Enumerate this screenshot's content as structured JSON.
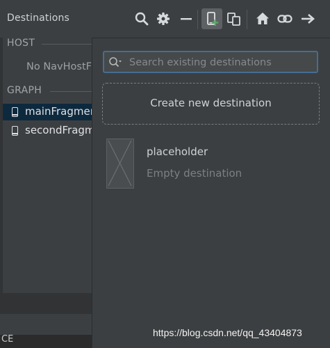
{
  "header": {
    "title": "Destinations",
    "icons": [
      "search-icon",
      "gear-icon",
      "minus-icon",
      "new-destination-icon",
      "nested-graph-icon",
      "home-icon",
      "link-icon",
      "arrow-right-icon"
    ]
  },
  "left_panel": {
    "host_section_label": "HOST",
    "host_value": "No NavHostFragments found",
    "graph_section_label": "GRAPH",
    "graph_items": [
      {
        "label": "mainFragment",
        "selected": true
      },
      {
        "label": "secondFragment",
        "selected": false
      }
    ],
    "bottom_text": "CE"
  },
  "popup": {
    "search_placeholder": "Search existing destinations",
    "search_value": "",
    "create_label": "Create new destination",
    "destinations": [
      {
        "name": "placeholder",
        "subtitle": "Empty destination"
      }
    ]
  },
  "watermark": "https://blog.csdn.net/qq_43404873",
  "colors": {
    "background": "#3c3f41",
    "selection": "#0d293e",
    "focus_border": "#466d94",
    "add_badge": "#59a869"
  }
}
